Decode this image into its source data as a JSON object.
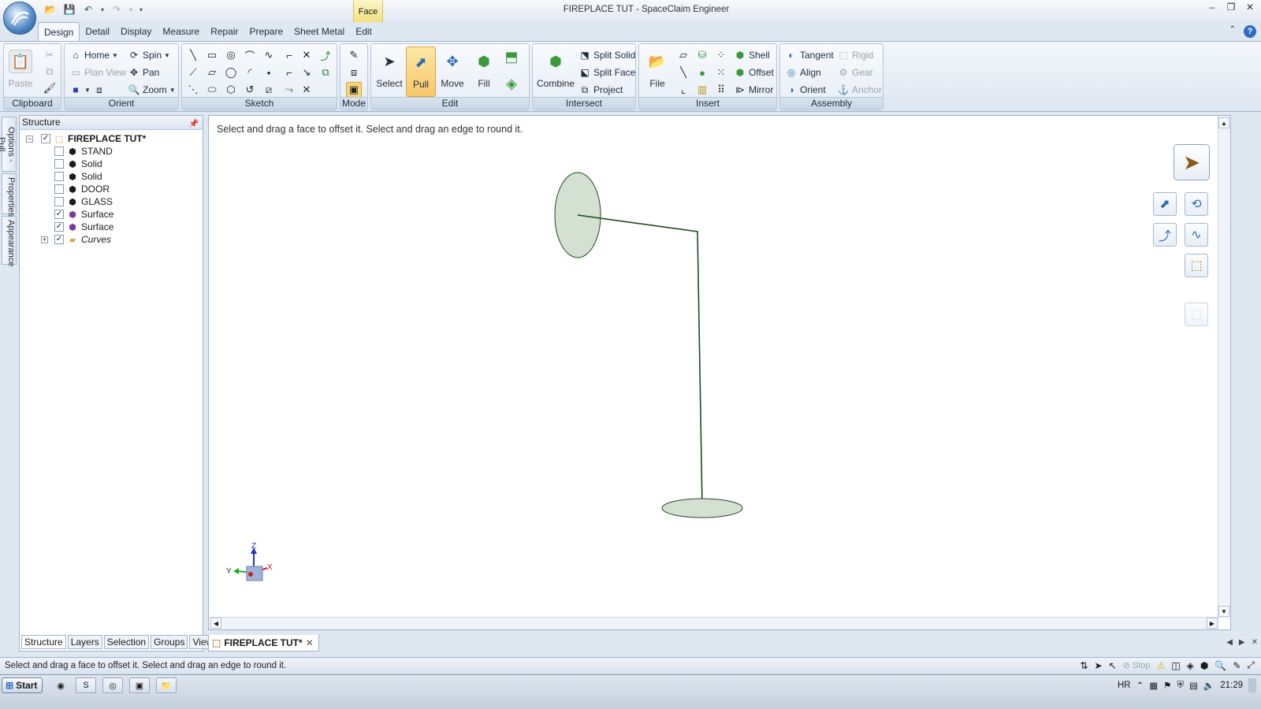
{
  "window": {
    "title": "FIREPLACE TUT - SpaceClaim Engineer",
    "context_tab": "Face"
  },
  "ribbon_tabs": [
    "Design",
    "Detail",
    "Display",
    "Measure",
    "Repair",
    "Prepare",
    "Sheet Metal",
    "Edit"
  ],
  "ribbon": {
    "clipboard": {
      "label": "Clipboard",
      "paste": "Paste"
    },
    "orient": {
      "label": "Orient",
      "home": "Home",
      "spin": "Spin",
      "plan_view": "Plan View",
      "pan": "Pan",
      "zoom": "Zoom"
    },
    "sketch": {
      "label": "Sketch"
    },
    "mode": {
      "label": "Mode"
    },
    "edit": {
      "label": "Edit",
      "select": "Select",
      "pull": "Pull",
      "move": "Move",
      "fill": "Fill"
    },
    "intersect": {
      "label": "Intersect",
      "combine": "Combine",
      "split_solid": "Split Solid",
      "split_face": "Split Face",
      "project": "Project"
    },
    "insert": {
      "label": "Insert",
      "file": "File",
      "shell": "Shell",
      "offset": "Offset",
      "mirror": "Mirror"
    },
    "assembly": {
      "label": "Assembly",
      "tangent": "Tangent",
      "align": "Align",
      "orient": "Orient",
      "rigid": "Rigid",
      "gear": "Gear",
      "anchor": "Anchor"
    }
  },
  "side_tabs": [
    "Options - Pull",
    "Properties",
    "Appearance"
  ],
  "structure": {
    "header": "Structure",
    "root": {
      "label": "FIREPLACE TUT*",
      "checked": true
    },
    "items": [
      {
        "label": "STAND",
        "checked": false,
        "icon": "solid-icon"
      },
      {
        "label": "Solid",
        "checked": false,
        "icon": "solid-icon"
      },
      {
        "label": "Solid",
        "checked": false,
        "icon": "solid-icon"
      },
      {
        "label": "DOOR",
        "checked": false,
        "icon": "solid-icon"
      },
      {
        "label": "GLASS",
        "checked": false,
        "icon": "solid-icon"
      },
      {
        "label": "Surface",
        "checked": true,
        "icon": "surface-icon"
      },
      {
        "label": "Surface",
        "checked": true,
        "icon": "surface-icon"
      },
      {
        "label": "Curves",
        "checked": true,
        "icon": "folder-icon"
      }
    ],
    "tabs": [
      "Structure",
      "Layers",
      "Selection",
      "Groups",
      "Views"
    ]
  },
  "viewport": {
    "hint": "Select and drag a face to offset it. Select and drag an edge to round it.",
    "triad": {
      "z": "Z",
      "y": "Y",
      "x": "X"
    }
  },
  "doc_tab": {
    "label": "FIREPLACE TUT*"
  },
  "statusbar": {
    "text": "Select and drag a face to offset it. Select and drag an edge to round it.",
    "stop": "Stop"
  },
  "taskbar": {
    "start": "Start",
    "lang": "HR",
    "time": "21:29"
  },
  "colors": {
    "shape_fill": "#d4e0d2",
    "shape_stroke": "#1f4a1f",
    "accent": "#2e6dbf"
  }
}
